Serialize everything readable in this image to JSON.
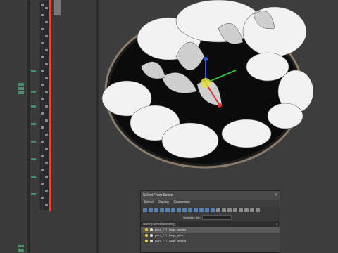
{
  "dialog": {
    "title": "Select From Scene",
    "close_label": "×",
    "menu": [
      "Select",
      "Display",
      "Customize"
    ],
    "selection_set_label": "Selection Set:",
    "list_header": "Name (Sorted Ascending)",
    "list_close": "×",
    "rows": [
      {
        "name": "plant_777_Dagg_garden",
        "selected": true
      },
      {
        "name": "plant_777_Dagg_grow",
        "selected": false
      },
      {
        "name": "plant_777_Dagg_ground",
        "selected": false
      }
    ]
  },
  "colors": {
    "accent_red": "#e0483f",
    "gizmo_x": "#e0302a",
    "gizmo_y": "#2fbf3a",
    "gizmo_z": "#2f5fe0",
    "gizmo_center": "#e8e040"
  },
  "icons": [
    "close-icon",
    "light-bulb-icon",
    "eye-icon",
    "toolbar-icon"
  ]
}
